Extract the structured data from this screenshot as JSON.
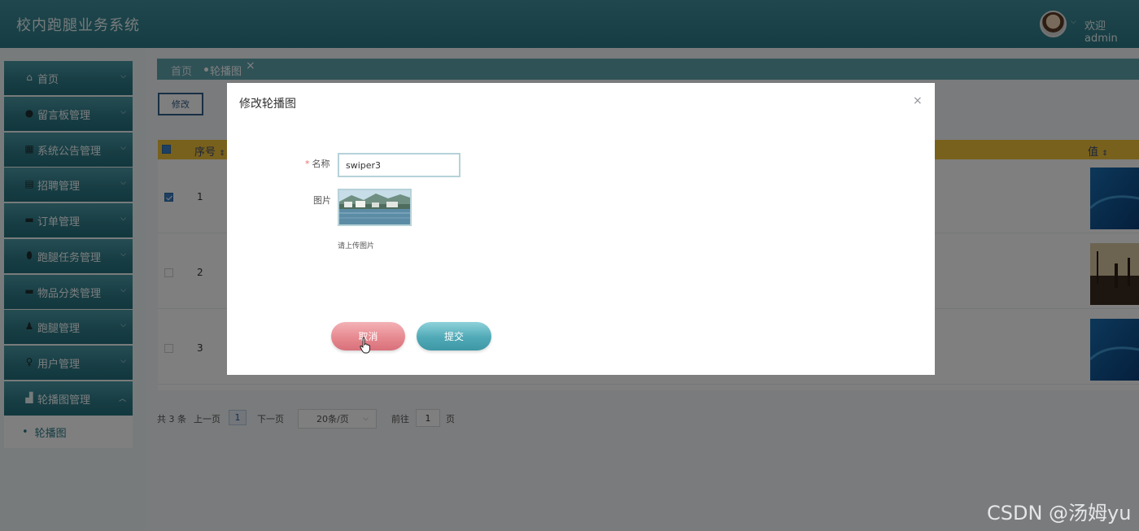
{
  "header": {
    "title": "校内跑腿业务系统",
    "welcome": "欢迎 admin"
  },
  "sidebar": {
    "items": [
      {
        "label": "首页",
        "icon": "home-icon"
      },
      {
        "label": "留言板管理",
        "icon": "message-icon"
      },
      {
        "label": "系统公告管理",
        "icon": "grid-icon"
      },
      {
        "label": "招聘管理",
        "icon": "building-icon"
      },
      {
        "label": "订单管理",
        "icon": "card-icon"
      },
      {
        "label": "跑腿任务管理",
        "icon": "drop-icon"
      },
      {
        "label": "物品分类管理",
        "icon": "folder-icon"
      },
      {
        "label": "跑腿管理",
        "icon": "user-icon"
      },
      {
        "label": "用户管理",
        "icon": "bulb-icon"
      },
      {
        "label": "轮播图管理",
        "icon": "image-icon"
      }
    ],
    "submenu": {
      "label": "轮播图"
    }
  },
  "breadcrumb": {
    "home": "首页",
    "current": "轮播图",
    "close": "×"
  },
  "toolbar": {
    "edit_label": "修改"
  },
  "table": {
    "headers": {
      "seq": "序号",
      "value": "值"
    },
    "rows": [
      {
        "seq": "1",
        "checked": true
      },
      {
        "seq": "2",
        "checked": false
      },
      {
        "seq": "3",
        "checked": false
      }
    ]
  },
  "pagination": {
    "total": "共 3 条",
    "prev": "上一页",
    "current": "1",
    "next": "下一页",
    "page_size": "20条/页",
    "goto": "前往",
    "goto_value": "1",
    "page_unit": "页"
  },
  "dialog": {
    "title": "修改轮播图",
    "close": "×",
    "name_required": "*",
    "name_label": "名称",
    "name_value": "swiper3",
    "image_label": "图片",
    "upload_hint": "请上传图片",
    "cancel_label": "取消",
    "submit_label": "提交"
  },
  "watermark": "CSDN @汤姆yu"
}
